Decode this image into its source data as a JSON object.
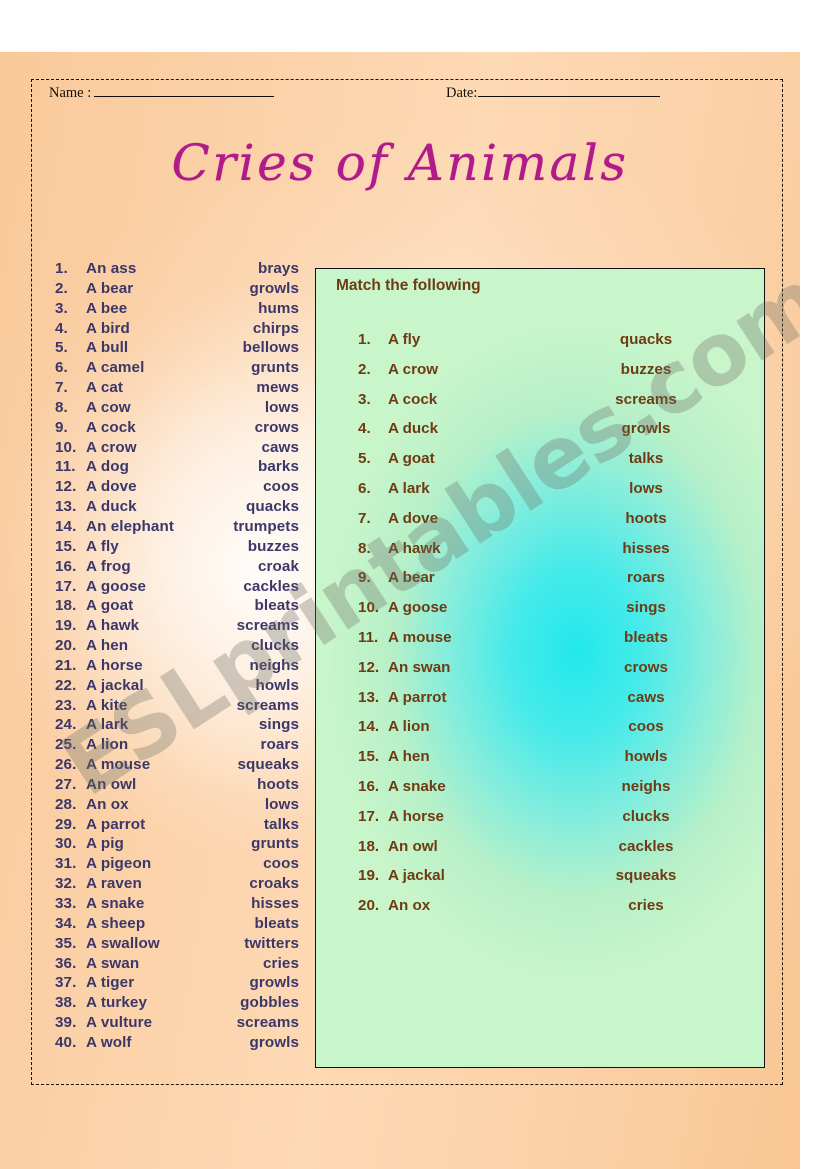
{
  "header": {
    "name_label": "Name :",
    "date_label": "Date:"
  },
  "title": "Cries of Animals",
  "watermark": "ESLprintables.com",
  "reference_list": [
    {
      "num": "1.",
      "animal": "An ass",
      "sound": "brays"
    },
    {
      "num": "2.",
      "animal": "A bear",
      "sound": "growls"
    },
    {
      "num": "3.",
      "animal": "A bee",
      "sound": "hums"
    },
    {
      "num": "4.",
      "animal": "A bird",
      "sound": "chirps"
    },
    {
      "num": "5.",
      "animal": "A bull",
      "sound": "bellows"
    },
    {
      "num": "6.",
      "animal": "A camel",
      "sound": "grunts"
    },
    {
      "num": "7.",
      "animal": "A cat",
      "sound": "mews"
    },
    {
      "num": "8.",
      "animal": "A cow",
      "sound": "lows"
    },
    {
      "num": "9.",
      "animal": "A cock",
      "sound": "crows"
    },
    {
      "num": "10.",
      "animal": "A crow",
      "sound": "caws"
    },
    {
      "num": "11.",
      "animal": "A dog",
      "sound": "barks"
    },
    {
      "num": "12.",
      "animal": "A dove",
      "sound": "coos"
    },
    {
      "num": "13.",
      "animal": "A duck",
      "sound": "quacks"
    },
    {
      "num": "14.",
      "animal": "An elephant",
      "sound": "trumpets"
    },
    {
      "num": "15.",
      "animal": "A fly",
      "sound": "buzzes"
    },
    {
      "num": "16.",
      "animal": "A frog",
      "sound": "croak"
    },
    {
      "num": "17.",
      "animal": "A goose",
      "sound": "cackles"
    },
    {
      "num": "18.",
      "animal": "A goat",
      "sound": "bleats"
    },
    {
      "num": "19.",
      "animal": "A hawk",
      "sound": "screams"
    },
    {
      "num": "20.",
      "animal": "A hen",
      "sound": "clucks"
    },
    {
      "num": "21.",
      "animal": "A horse",
      "sound": "neighs"
    },
    {
      "num": "22.",
      "animal": "A jackal",
      "sound": "howls"
    },
    {
      "num": "23.",
      "animal": "A kite",
      "sound": "screams"
    },
    {
      "num": "24.",
      "animal": "A lark",
      "sound": "sings"
    },
    {
      "num": "25.",
      "animal": "A lion",
      "sound": "roars"
    },
    {
      "num": "26.",
      "animal": "A mouse",
      "sound": "squeaks"
    },
    {
      "num": "27.",
      "animal": "An owl",
      "sound": "hoots"
    },
    {
      "num": "28.",
      "animal": "An ox",
      "sound": "lows"
    },
    {
      "num": "29.",
      "animal": "A parrot",
      "sound": "talks"
    },
    {
      "num": "30.",
      "animal": "A pig",
      "sound": "grunts"
    },
    {
      "num": "31.",
      "animal": "A pigeon",
      "sound": "coos"
    },
    {
      "num": "32.",
      "animal": "A raven",
      "sound": "croaks"
    },
    {
      "num": "33.",
      "animal": "A snake",
      "sound": "hisses"
    },
    {
      "num": "34.",
      "animal": "A sheep",
      "sound": "bleats"
    },
    {
      "num": "35.",
      "animal": "A swallow",
      "sound": "twitters"
    },
    {
      "num": "36.",
      "animal": "A swan",
      "sound": "cries"
    },
    {
      "num": "37.",
      "animal": "A tiger",
      "sound": "growls"
    },
    {
      "num": "38.",
      "animal": "A turkey",
      "sound": "gobbles"
    },
    {
      "num": "39.",
      "animal": "A vulture",
      "sound": "screams"
    },
    {
      "num": "40.",
      "animal": "A wolf",
      "sound": "growls"
    }
  ],
  "exercise": {
    "instruction": "Match the following",
    "items": [
      {
        "num": "1.",
        "animal": "A fly",
        "sound": "quacks"
      },
      {
        "num": "2.",
        "animal": "A crow",
        "sound": "buzzes"
      },
      {
        "num": "3.",
        "animal": "A cock",
        "sound": "screams"
      },
      {
        "num": "4.",
        "animal": "A duck",
        "sound": "growls"
      },
      {
        "num": "5.",
        "animal": "A goat",
        "sound": "talks"
      },
      {
        "num": "6.",
        "animal": "A lark",
        "sound": "lows"
      },
      {
        "num": "7.",
        "animal": "A dove",
        "sound": "hoots"
      },
      {
        "num": "8.",
        "animal": "A hawk",
        "sound": "hisses"
      },
      {
        "num": "9.",
        "animal": "A bear",
        "sound": "roars"
      },
      {
        "num": "10.",
        "animal": "A goose",
        "sound": "sings"
      },
      {
        "num": "11.",
        "animal": "A mouse",
        "sound": "bleats"
      },
      {
        "num": "12.",
        "animal": "An swan",
        "sound": "crows"
      },
      {
        "num": "13.",
        "animal": "A parrot",
        "sound": "caws"
      },
      {
        "num": "14.",
        "animal": "A lion",
        "sound": "coos"
      },
      {
        "num": "15.",
        "animal": "A hen",
        "sound": "howls"
      },
      {
        "num": "16.",
        "animal": "A snake",
        "sound": "neighs"
      },
      {
        "num": "17.",
        "animal": "A horse",
        "sound": "clucks"
      },
      {
        "num": "18.",
        "animal": "An owl",
        "sound": "cackles"
      },
      {
        "num": "19.",
        "animal": "A jackal",
        "sound": "squeaks"
      },
      {
        "num": "20.",
        "animal": "An ox",
        "sound": "cries"
      }
    ]
  }
}
